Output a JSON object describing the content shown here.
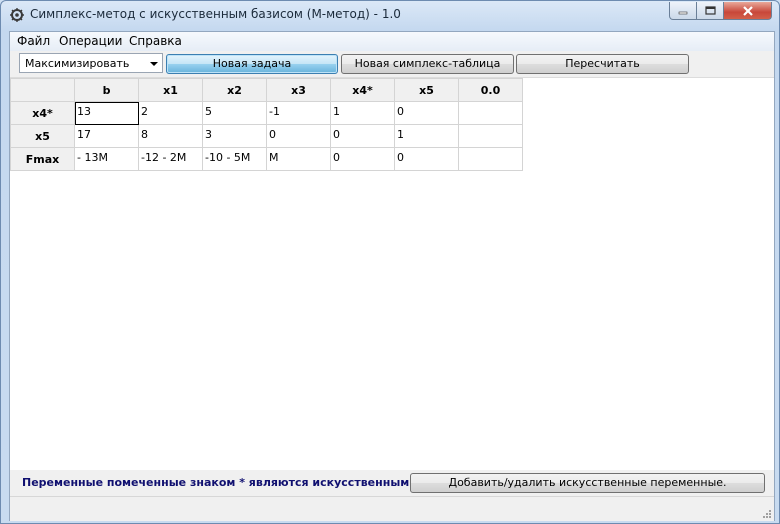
{
  "window": {
    "title": "Симплекс-метод с искусственным базисом (М-метод) - 1.0",
    "icon": "app-gear-icon",
    "controls": [
      "minimize-icon",
      "maximize-icon",
      "close-icon"
    ]
  },
  "menu": {
    "items": [
      "Файл",
      "Операции",
      "Справка"
    ]
  },
  "toolbar": {
    "mode_select": "Максимизировать",
    "new_task_label": "Новая задача",
    "new_table_label": "Новая симплекс-таблица",
    "recalc_label": "Пересчитать"
  },
  "table": {
    "columns": [
      "",
      "b",
      "x1",
      "x2",
      "x3",
      "x4*",
      "x5",
      "0.0"
    ],
    "rows": [
      {
        "header": "x4*",
        "cells": [
          "13",
          "2",
          "5",
          "-1",
          "1",
          "0",
          ""
        ]
      },
      {
        "header": "x5",
        "cells": [
          "17",
          "8",
          "3",
          "0",
          "0",
          "1",
          ""
        ]
      },
      {
        "header": "Fmax",
        "cells": [
          "- 13M",
          "-12 - 2M",
          "-10 - 5M",
          "M",
          "0",
          "0",
          ""
        ]
      }
    ]
  },
  "footer": {
    "note": "Переменные помеченные знаком * являются искусственными.",
    "toggle_label": "Добавить/удалить искусственные переменные."
  },
  "colors": {
    "accent": "#3c7fb1",
    "note_text": "#101070",
    "close_button": "#c8473a"
  }
}
